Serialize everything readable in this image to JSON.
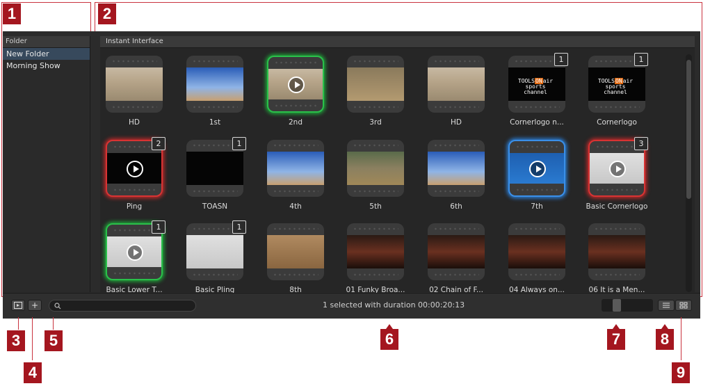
{
  "callouts": [
    "1",
    "2",
    "3",
    "4",
    "5",
    "6",
    "7",
    "8",
    "9"
  ],
  "sidebar": {
    "header": "Folder",
    "items": [
      {
        "label": "New Folder",
        "selected": true
      },
      {
        "label": "Morning Show",
        "selected": false
      }
    ]
  },
  "main": {
    "header": "Instant Interface"
  },
  "tiles": [
    {
      "label": "HD",
      "badge": ""
    },
    {
      "label": "1st",
      "badge": ""
    },
    {
      "label": "2nd",
      "badge": ""
    },
    {
      "label": "3rd",
      "badge": ""
    },
    {
      "label": "HD",
      "badge": ""
    },
    {
      "label": "Cornerlogo n...",
      "badge": "1"
    },
    {
      "label": "Cornerlogo",
      "badge": "1"
    },
    {
      "label": "Ping",
      "badge": "2"
    },
    {
      "label": "TOASN",
      "badge": "1"
    },
    {
      "label": "4th",
      "badge": ""
    },
    {
      "label": "5th",
      "badge": ""
    },
    {
      "label": "6th",
      "badge": ""
    },
    {
      "label": "7th",
      "badge": ""
    },
    {
      "label": "Basic Cornerlogo",
      "badge": "3"
    },
    {
      "label": "Basic Lower T...",
      "badge": "1"
    },
    {
      "label": "Basic Pling",
      "badge": "1"
    },
    {
      "label": "8th",
      "badge": ""
    },
    {
      "label": "01 Funky Broa...",
      "badge": ""
    },
    {
      "label": "02 Chain of F...",
      "badge": ""
    },
    {
      "label": "04 Always on...",
      "badge": ""
    },
    {
      "label": "06 It is a Men...",
      "badge": ""
    }
  ],
  "logo_text": {
    "line1a": "TOOLS",
    "line1b": "ON",
    "line1c": "air",
    "line2": "sports channel"
  },
  "toolbar": {
    "add_label": "+",
    "search_placeholder": "",
    "status": "1 selected with duration 00:00:20:13"
  },
  "colors": {
    "accent_red": "#a4161f",
    "glow_green": "#2ac04a",
    "glow_red": "#d83333",
    "glow_blue": "#3a8fe8"
  }
}
